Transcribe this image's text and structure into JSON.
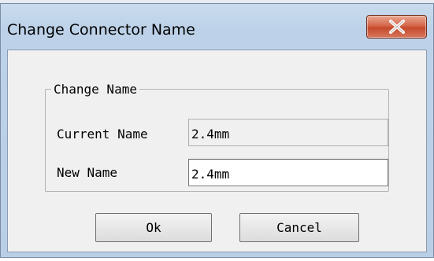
{
  "window": {
    "title": "Change Connector Name",
    "close_glyph": "X"
  },
  "group": {
    "legend": "Change Name"
  },
  "fields": {
    "current_label": "Current Name",
    "current_value": "2.4mm",
    "new_label": "New Name",
    "new_value": "2.4mm"
  },
  "buttons": {
    "ok_label": "Ok",
    "cancel_label": "Cancel"
  },
  "colors": {
    "titlebar": "#bdd2e8",
    "close_button": "#c44a2b",
    "client_background": "#f0f0f0"
  }
}
